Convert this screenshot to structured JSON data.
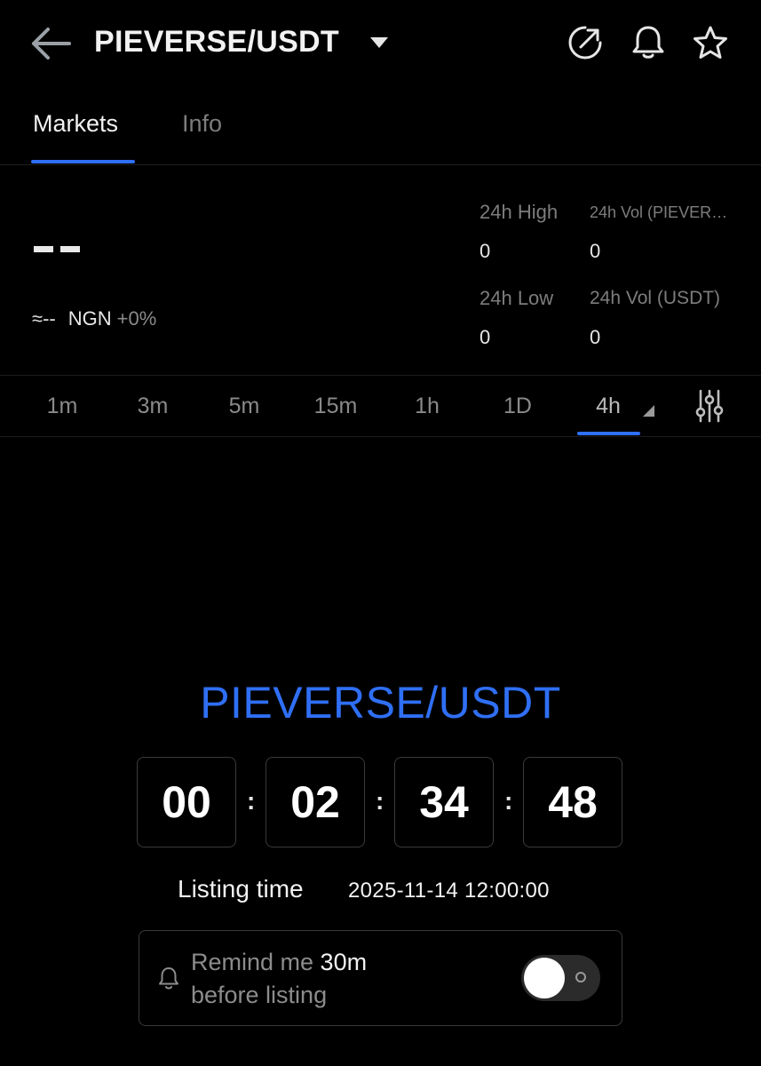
{
  "header": {
    "title": "PIEVERSE/USDT",
    "icons": [
      "back-arrow-icon",
      "caret-down-icon",
      "share-icon",
      "bell-icon",
      "star-icon"
    ]
  },
  "tabs": [
    {
      "label": "Markets",
      "active": true
    },
    {
      "label": "Info",
      "active": false
    }
  ],
  "price": {
    "approx_prefix": "≈--",
    "currency": "NGN",
    "change": "+0%"
  },
  "stats": {
    "high_label": "24h High",
    "high_value": "0",
    "vol_base_label": "24h Vol (PIEVER…",
    "vol_base_value": "0",
    "low_label": "24h Low",
    "low_value": "0",
    "vol_quote_label": "24h Vol  (USDT)",
    "vol_quote_value": "0"
  },
  "intervals": [
    "1m",
    "3m",
    "5m",
    "15m",
    "1h",
    "1D",
    "4h"
  ],
  "selected_interval": "4h",
  "countdown": {
    "title": "PIEVERSE/USDT",
    "hours": "00",
    "minutes": "02",
    "seconds": "34",
    "frames": "48"
  },
  "listing": {
    "label": "Listing time",
    "time": "2025-11-14 12:00:00"
  },
  "reminder": {
    "prefix": "Remind me ",
    "amount": "30m",
    "suffix": "before listing",
    "enabled": false
  },
  "colors": {
    "accent": "#2f6ff5",
    "background": "#000000",
    "muted_text": "#7d7d7d"
  }
}
